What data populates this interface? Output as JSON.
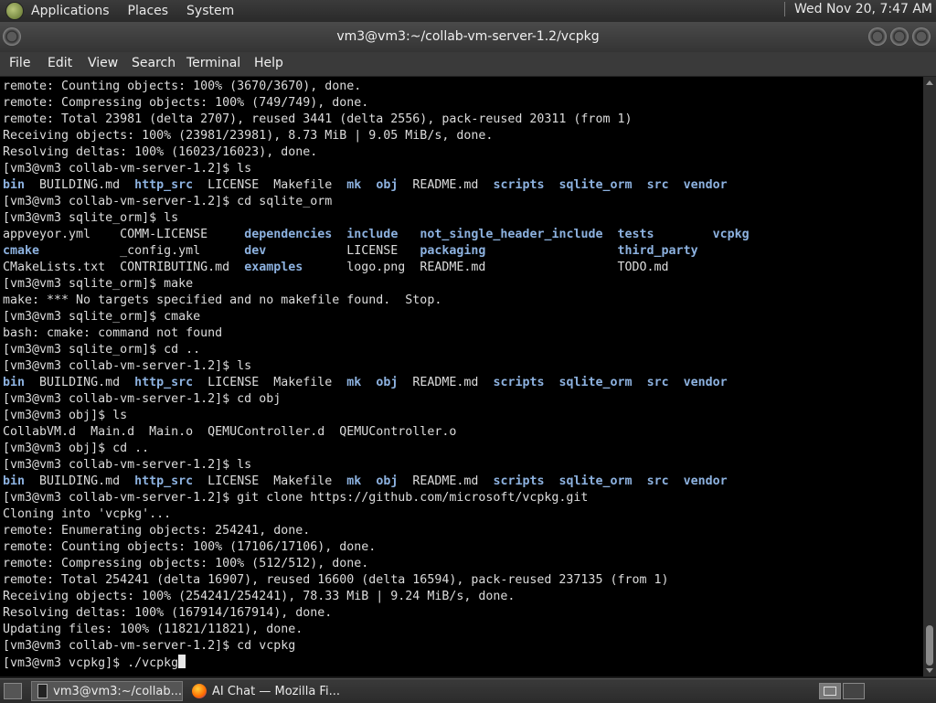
{
  "top_panel": {
    "menus": [
      "Applications",
      "Places",
      "System"
    ],
    "clock": "Wed Nov 20,  7:47 AM"
  },
  "window": {
    "title": "vm3@vm3:~/collab-vm-server-1.2/vcpkg"
  },
  "menubar": {
    "items": [
      "File",
      "Edit",
      "View",
      "Search",
      "Terminal",
      "Help"
    ]
  },
  "terminal": {
    "lines": [
      [
        {
          "t": "remote: Counting objects: 100% (3670/3670), done."
        }
      ],
      [
        {
          "t": "remote: Compressing objects: 100% (749/749), done."
        }
      ],
      [
        {
          "t": "remote: Total 23981 (delta 2707), reused 3441 (delta 2556), pack-reused 20311 (from 1)"
        }
      ],
      [
        {
          "t": "Receiving objects: 100% (23981/23981), 8.73 MiB | 9.05 MiB/s, done."
        }
      ],
      [
        {
          "t": "Resolving deltas: 100% (16023/16023), done."
        }
      ],
      [
        {
          "t": "[vm3@vm3 collab-vm-server-1.2]$ ls"
        }
      ],
      [
        {
          "t": "bin",
          "d": 1
        },
        {
          "t": "  BUILDING.md  "
        },
        {
          "t": "http_src",
          "d": 1
        },
        {
          "t": "  LICENSE  Makefile  "
        },
        {
          "t": "mk",
          "d": 1
        },
        {
          "t": "  "
        },
        {
          "t": "obj",
          "d": 1
        },
        {
          "t": "  README.md  "
        },
        {
          "t": "scripts",
          "d": 1
        },
        {
          "t": "  "
        },
        {
          "t": "sqlite_orm",
          "d": 1
        },
        {
          "t": "  "
        },
        {
          "t": "src",
          "d": 1
        },
        {
          "t": "  "
        },
        {
          "t": "vendor",
          "d": 1
        }
      ],
      [
        {
          "t": "[vm3@vm3 collab-vm-server-1.2]$ cd sqlite_orm"
        }
      ],
      [
        {
          "t": "[vm3@vm3 sqlite_orm]$ ls"
        }
      ],
      [
        {
          "t": "appveyor.yml    COMM-LICENSE     "
        },
        {
          "t": "dependencies",
          "d": 1
        },
        {
          "t": "  "
        },
        {
          "t": "include",
          "d": 1
        },
        {
          "t": "   "
        },
        {
          "t": "not_single_header_include",
          "d": 1
        },
        {
          "t": "  "
        },
        {
          "t": "tests",
          "d": 1
        },
        {
          "t": "        "
        },
        {
          "t": "vcpkg",
          "d": 1
        }
      ],
      [
        {
          "t": "cmake",
          "d": 1
        },
        {
          "t": "           _config.yml      "
        },
        {
          "t": "dev",
          "d": 1
        },
        {
          "t": "           LICENSE   "
        },
        {
          "t": "packaging",
          "d": 1
        },
        {
          "t": "                  "
        },
        {
          "t": "third_party",
          "d": 1
        }
      ],
      [
        {
          "t": "CMakeLists.txt  CONTRIBUTING.md  "
        },
        {
          "t": "examples",
          "d": 1
        },
        {
          "t": "      logo.png  README.md                  TODO.md"
        }
      ],
      [
        {
          "t": "[vm3@vm3 sqlite_orm]$ make"
        }
      ],
      [
        {
          "t": "make: *** No targets specified and no makefile found.  Stop."
        }
      ],
      [
        {
          "t": "[vm3@vm3 sqlite_orm]$ cmake"
        }
      ],
      [
        {
          "t": "bash: cmake: command not found"
        }
      ],
      [
        {
          "t": "[vm3@vm3 sqlite_orm]$ cd .."
        }
      ],
      [
        {
          "t": "[vm3@vm3 collab-vm-server-1.2]$ ls"
        }
      ],
      [
        {
          "t": "bin",
          "d": 1
        },
        {
          "t": "  BUILDING.md  "
        },
        {
          "t": "http_src",
          "d": 1
        },
        {
          "t": "  LICENSE  Makefile  "
        },
        {
          "t": "mk",
          "d": 1
        },
        {
          "t": "  "
        },
        {
          "t": "obj",
          "d": 1
        },
        {
          "t": "  README.md  "
        },
        {
          "t": "scripts",
          "d": 1
        },
        {
          "t": "  "
        },
        {
          "t": "sqlite_orm",
          "d": 1
        },
        {
          "t": "  "
        },
        {
          "t": "src",
          "d": 1
        },
        {
          "t": "  "
        },
        {
          "t": "vendor",
          "d": 1
        }
      ],
      [
        {
          "t": "[vm3@vm3 collab-vm-server-1.2]$ cd obj"
        }
      ],
      [
        {
          "t": "[vm3@vm3 obj]$ ls"
        }
      ],
      [
        {
          "t": "CollabVM.d  Main.d  Main.o  QEMUController.d  QEMUController.o"
        }
      ],
      [
        {
          "t": "[vm3@vm3 obj]$ cd .."
        }
      ],
      [
        {
          "t": "[vm3@vm3 collab-vm-server-1.2]$ ls"
        }
      ],
      [
        {
          "t": "bin",
          "d": 1
        },
        {
          "t": "  BUILDING.md  "
        },
        {
          "t": "http_src",
          "d": 1
        },
        {
          "t": "  LICENSE  Makefile  "
        },
        {
          "t": "mk",
          "d": 1
        },
        {
          "t": "  "
        },
        {
          "t": "obj",
          "d": 1
        },
        {
          "t": "  README.md  "
        },
        {
          "t": "scripts",
          "d": 1
        },
        {
          "t": "  "
        },
        {
          "t": "sqlite_orm",
          "d": 1
        },
        {
          "t": "  "
        },
        {
          "t": "src",
          "d": 1
        },
        {
          "t": "  "
        },
        {
          "t": "vendor",
          "d": 1
        }
      ],
      [
        {
          "t": "[vm3@vm3 collab-vm-server-1.2]$ git clone https://github.com/microsoft/vcpkg.git"
        }
      ],
      [
        {
          "t": "Cloning into 'vcpkg'..."
        }
      ],
      [
        {
          "t": "remote: Enumerating objects: 254241, done."
        }
      ],
      [
        {
          "t": "remote: Counting objects: 100% (17106/17106), done."
        }
      ],
      [
        {
          "t": "remote: Compressing objects: 100% (512/512), done."
        }
      ],
      [
        {
          "t": "remote: Total 254241 (delta 16907), reused 16600 (delta 16594), pack-reused 237135 (from 1)"
        }
      ],
      [
        {
          "t": "Receiving objects: 100% (254241/254241), 78.33 MiB | 9.24 MiB/s, done."
        }
      ],
      [
        {
          "t": "Resolving deltas: 100% (167914/167914), done."
        }
      ],
      [
        {
          "t": "Updating files: 100% (11821/11821), done."
        }
      ],
      [
        {
          "t": "[vm3@vm3 collab-vm-server-1.2]$ cd vcpkg"
        }
      ],
      [
        {
          "t": "[vm3@vm3 vcpkg]$ ./vcpkg"
        }
      ]
    ],
    "colors": {
      "text": "#dcdcdc",
      "directory": "#8db2e0",
      "background": "#000000"
    }
  },
  "taskbar": {
    "tasks": [
      {
        "label": "vm3@vm3:~/collab...",
        "active": true
      },
      {
        "label": "AI Chat — Mozilla Fi...",
        "active": false
      }
    ]
  }
}
